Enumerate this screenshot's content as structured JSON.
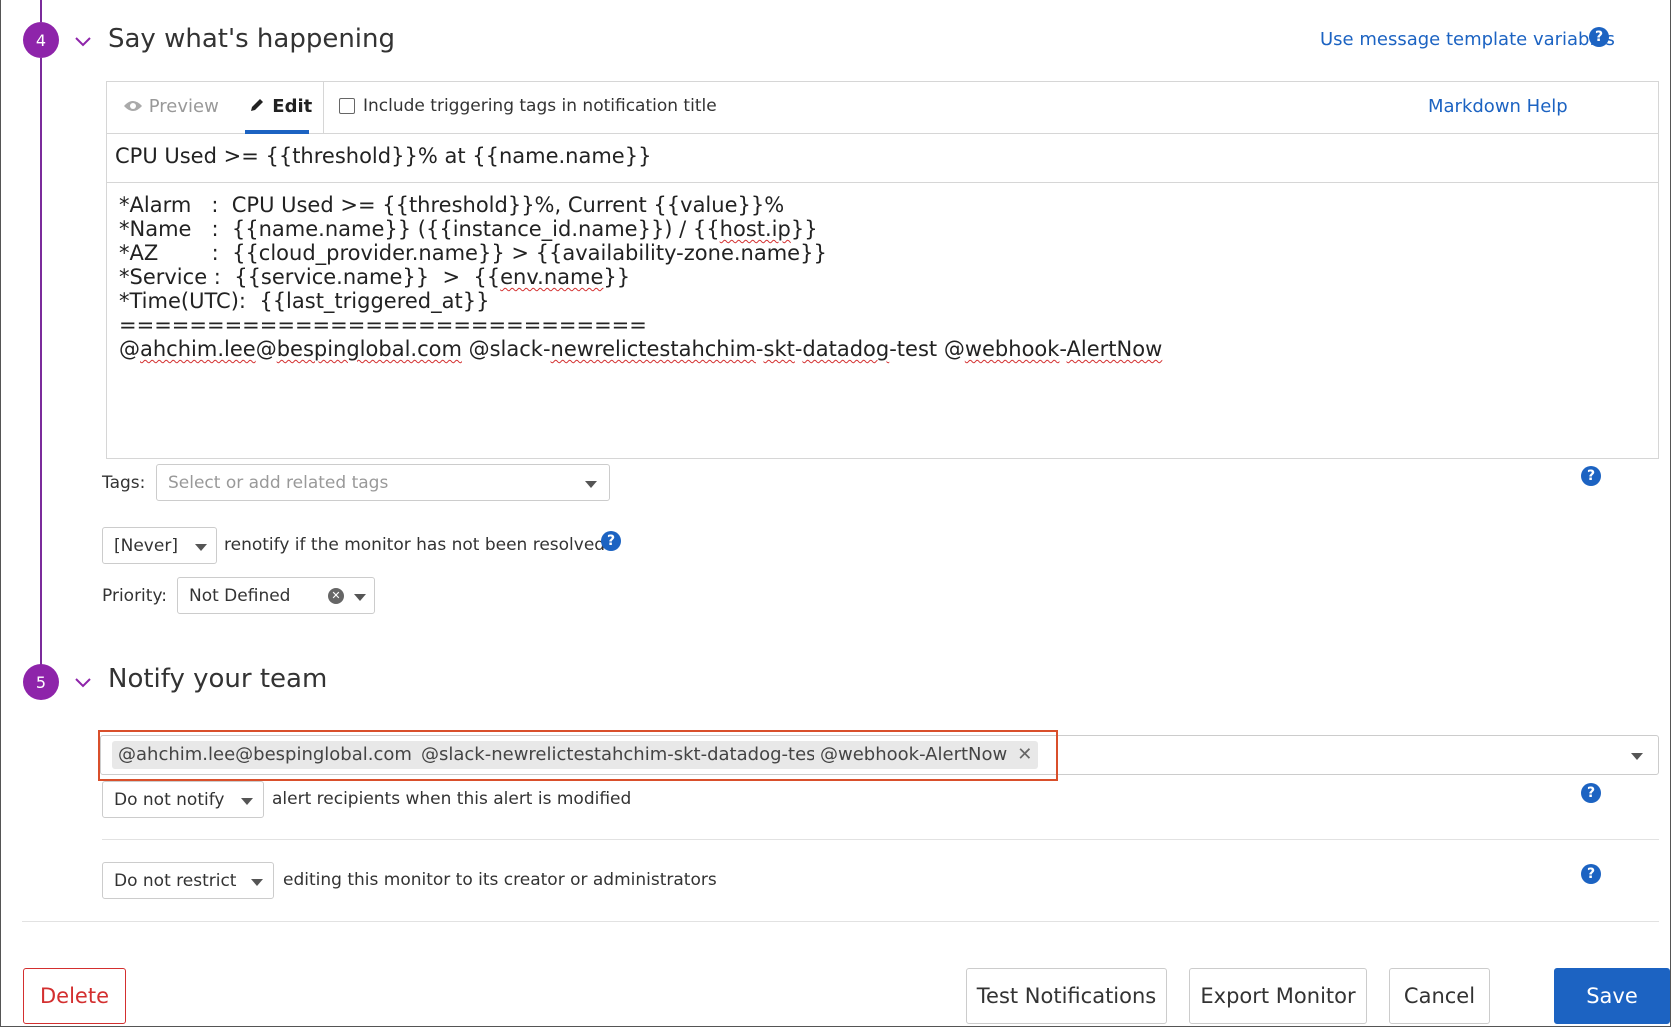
{
  "section4": {
    "step": "4",
    "title": "Say what's happening",
    "template_link": "Use message template variables"
  },
  "editor": {
    "tab_preview": "Preview",
    "tab_edit": "Edit",
    "include_tags_label": "Include triggering tags in notification title",
    "include_tags_checked": false,
    "markdown_help": "Markdown Help",
    "title_value": "CPU Used >= {{threshold}}% at {{name.name}}",
    "body_lines": [
      "*Alarm   :  CPU Used >= {{threshold}}%, Current {{value}}%",
      "*Name   :  {{name.name}} ({{instance_id.name}}) / {{host.ip}}",
      "*AZ        :  {{cloud_provider.name}} > {{availability-zone.name}}",
      "*Service :  {{service.name}}  >  {{env.name}}",
      "*Time(UTC):  {{last_triggered_at}}",
      "==============================",
      "@ahchim.lee@bespinglobal.com @slack-newrelictestahchim-skt-datadog-test @webhook-AlertNow"
    ]
  },
  "tags": {
    "label": "Tags:",
    "placeholder": "Select or add related tags"
  },
  "renotify": {
    "value": "[Never]",
    "text": "renotify if the monitor has not been resolved"
  },
  "priority": {
    "label": "Priority:",
    "value": "Not Defined"
  },
  "section5": {
    "step": "5",
    "title": "Notify your team"
  },
  "recipients": [
    "@ahchim.lee@bespinglobal.com",
    "@slack-newrelictestahchim-skt-datadog-test",
    "@webhook-AlertNow"
  ],
  "modify_notify": {
    "value": "Do not notify",
    "text": "alert recipients when this alert is modified"
  },
  "restrict": {
    "value": "Do not restrict",
    "text": "editing this monitor to its creator or administrators"
  },
  "buttons": {
    "delete": "Delete",
    "test_notifications": "Test Notifications",
    "export_monitor": "Export Monitor",
    "cancel": "Cancel",
    "save": "Save"
  },
  "colors": {
    "step_purple": "#8e24aa",
    "link_blue": "#1c63c2",
    "highlight_red": "#d94f2b",
    "delete_red": "#d32f2f"
  },
  "icons": {
    "help": "question-circle-icon",
    "preview": "eye-icon",
    "edit": "pencil-icon",
    "chevron": "chevron-down-icon",
    "caret": "caret-down-icon",
    "clear": "clear-circle-icon",
    "remove": "close-icon"
  }
}
